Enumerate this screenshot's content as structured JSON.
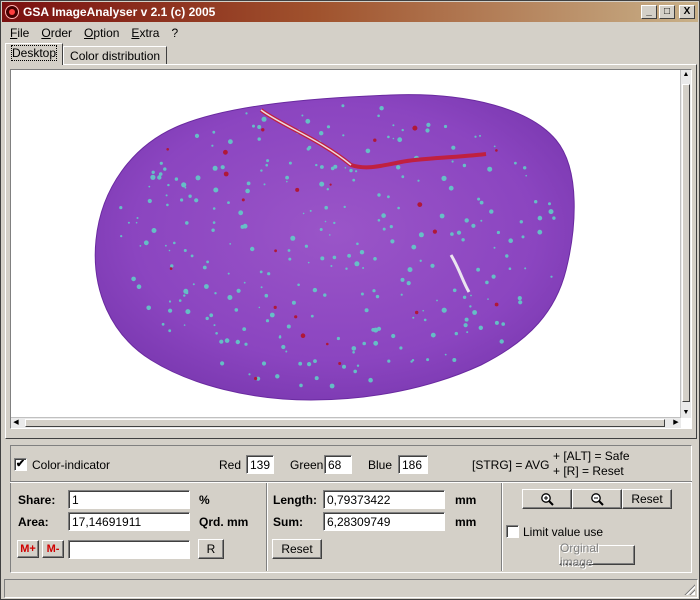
{
  "window": {
    "title": "GSA ImageAnalyser v 2.1 (c) 2005"
  },
  "titlebar_buttons": {
    "minimize": "_",
    "maximize": "□",
    "close": "X"
  },
  "menu": [
    {
      "accel": "F",
      "rest": "ile"
    },
    {
      "accel": "O",
      "rest": "rder"
    },
    {
      "accel": "O",
      "rest": "ption"
    },
    {
      "accel": "E",
      "rest": "xtra"
    },
    {
      "accel": "",
      "rest": "?"
    }
  ],
  "tabs": [
    "Desktop",
    "Color distribution"
  ],
  "active_tab": "Desktop",
  "colors": {
    "stain_purple": "#8b45c0",
    "stain_cyan": "#5fd4c8",
    "stain_red": "#c02040"
  },
  "color_indicator": {
    "checked": "✔",
    "label": "Color-indicator",
    "red_label": "Red",
    "red_value": "139",
    "green_label": "Green",
    "green_value": "68",
    "blue_label": "Blue",
    "blue_value": "186",
    "hint_avg": "[STRG] = AVG",
    "hint_safe": "+ [ALT] = Safe",
    "hint_reset": "+ [R] = Reset"
  },
  "share": {
    "label": "Share:",
    "value": "1",
    "unit": "%"
  },
  "area": {
    "label": "Area:",
    "value": "17,14691911",
    "unit": "Qrd. mm"
  },
  "memory": {
    "m_plus": "M+",
    "m_minus": "M-",
    "value": "",
    "r_button": "R"
  },
  "length": {
    "label": "Length:",
    "value": "0,79373422",
    "unit": "mm"
  },
  "sum": {
    "label": "Sum:",
    "value": "6,28309749",
    "unit": "mm"
  },
  "reset_button": "Reset",
  "zoom": {
    "reset_button": "Reset"
  },
  "limit_value_use": {
    "checked": "",
    "label": "Limit value use"
  },
  "original_image_button": "Orginal image"
}
